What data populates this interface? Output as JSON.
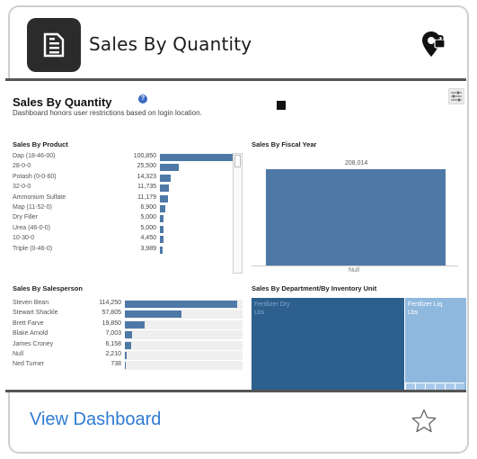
{
  "card": {
    "title": "Sales By Quantity",
    "app_icon": "document-list-icon",
    "lock_icon": "location-lock-icon",
    "view_link": "View Dashboard",
    "favorite_icon": "star-outline-icon"
  },
  "dashboard": {
    "title": "Sales By Quantity",
    "subtitle": "Dashboard honors user restrictions based on login location.",
    "help_icon_text": "?",
    "filter_icon": "sliders-icon",
    "sections": {
      "product": "Sales By Product",
      "fiscal_year": "Sales By Fiscal Year",
      "salesperson": "Sales By Salesperson",
      "department": "Sales By Department/By Inventory Unit"
    }
  },
  "colors": {
    "bar": "#4e79a7",
    "treemap_dark": "#2d5f8d",
    "treemap_light": "#8fb8de",
    "link": "#2f7bd3"
  },
  "chart_data": [
    {
      "type": "bar",
      "title": "Sales By Product",
      "categories": [
        "Dap (18-46-00)",
        "28-0-0",
        "Potash (0-0-60)",
        "32-0-0",
        "Ammonium Sulfate",
        "Map (11-52-0)",
        "Dry Filler",
        "Urea (46-0-0)",
        "10-30-0",
        "Triple (0-46-0)"
      ],
      "values": [
        100850,
        25500,
        14323,
        11735,
        11179,
        6900,
        5000,
        5000,
        4450,
        3989
      ],
      "labels": [
        "100,850",
        "25,500",
        "14,323",
        "11,735",
        "11,179",
        "6,900",
        "5,000",
        "5,000",
        "4,450",
        "3,989"
      ]
    },
    {
      "type": "bar",
      "title": "Sales By Fiscal Year",
      "categories": [
        "Null"
      ],
      "values": [
        208014
      ],
      "labels": [
        "208,014"
      ]
    },
    {
      "type": "bar",
      "title": "Sales By Salesperson",
      "categories": [
        "Steven Bean",
        "Stewart Shackle",
        "Brett Farve",
        "Blake Arnold",
        "James Croney",
        "Null",
        "Ned Turner"
      ],
      "values": [
        114250,
        57805,
        19850,
        7003,
        6158,
        2210,
        738
      ],
      "labels": [
        "114,250",
        "57,805",
        "19,850",
        "7,003",
        "6,158",
        "2,210",
        "738"
      ]
    },
    {
      "type": "heatmap",
      "title": "Sales By Department/By Inventory Unit",
      "cells": [
        {
          "name": "Fertilizer Dry",
          "unit": "Lbs"
        },
        {
          "name": "Fertilizer Liq",
          "unit": "Lbs"
        }
      ]
    }
  ]
}
